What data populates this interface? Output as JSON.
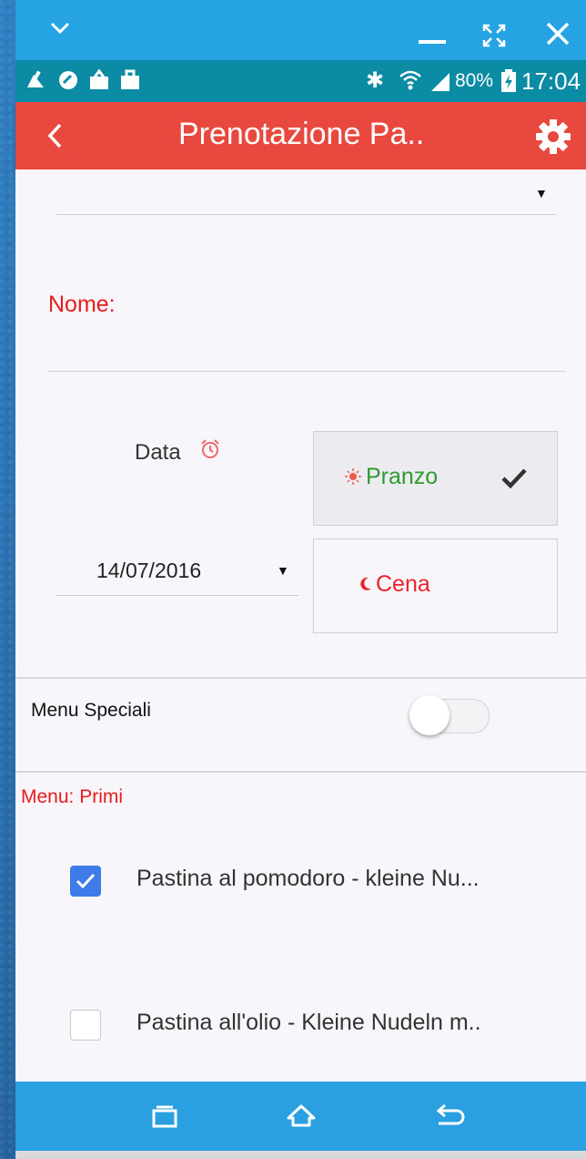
{
  "status": {
    "battery": "80%",
    "time": "17:04"
  },
  "app_bar": {
    "title": "Prenotazione Pa.."
  },
  "form": {
    "dropdown_value": "",
    "name_label": "Nome:",
    "name_value": "",
    "date_label": "Data",
    "date_value": "14/07/2016",
    "meal_options": [
      {
        "label": "Pranzo",
        "selected": true,
        "color": "#2e9b2e"
      },
      {
        "label": "Cena",
        "selected": false,
        "color": "#e8232b"
      }
    ],
    "special_menu_label": "Menu Speciali",
    "special_menu_on": false
  },
  "menu": {
    "section_label": "Menu: Primi",
    "items": [
      {
        "label": "Pastina al pomodoro - kleine Nu...",
        "checked": true
      },
      {
        "label": "Pastina all'olio - Kleine Nudeln m..",
        "checked": false
      }
    ]
  },
  "colors": {
    "accent": "#e8483e",
    "checkbox": "#3c7be8",
    "label_red": "#e81c1c"
  },
  "icons": [
    "chevron-down-icon",
    "minimize-icon",
    "fullscreen-icon",
    "close-icon",
    "back-icon",
    "settings-gear-icon",
    "alarm-clock-icon",
    "sun-icon",
    "moon-icon",
    "checkmark-icon",
    "recent-apps-icon",
    "home-icon",
    "back-nav-icon"
  ]
}
